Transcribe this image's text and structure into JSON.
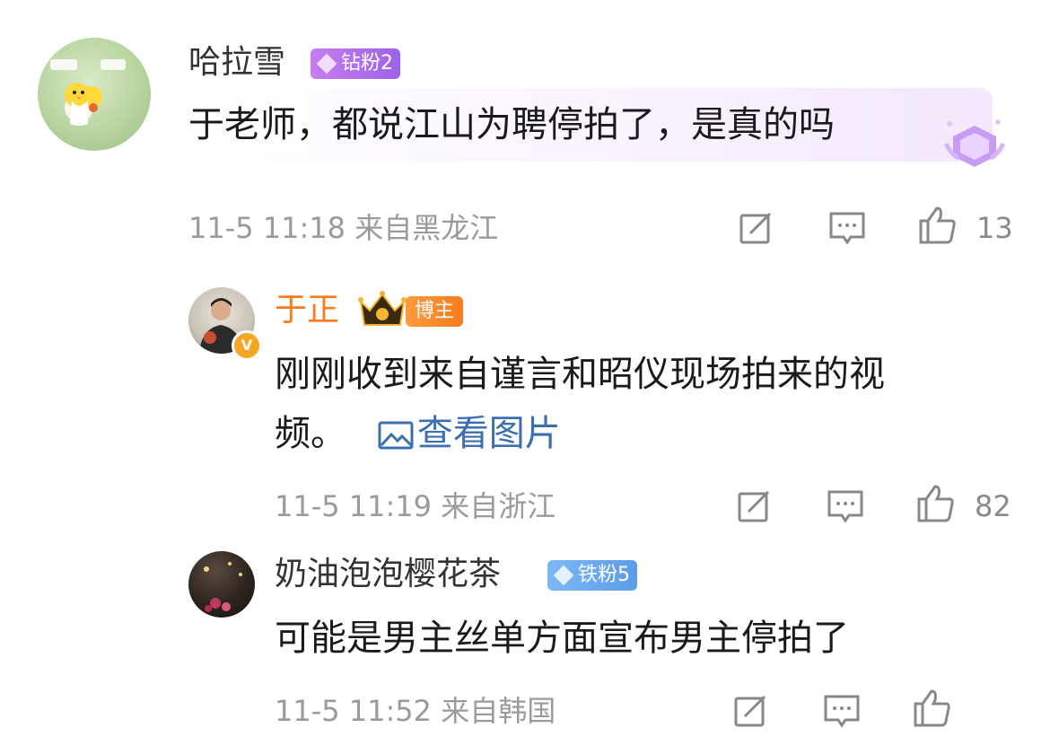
{
  "comments": [
    {
      "username": "哈拉雪",
      "badge": "钻粉2",
      "text": "于老师，都说江山为聘停拍了，是真的吗",
      "date": "11-5 11:18",
      "location": "来自黑龙江",
      "likes": "13"
    },
    {
      "username": "于正",
      "badge": "博主",
      "text_line1": "刚刚收到来自谨言和昭仪现场拍来的视",
      "text_line2": "频。",
      "link": "查看图片",
      "date": "11-5 11:19",
      "location": "来自浙江",
      "likes": "82"
    },
    {
      "username": "奶油泡泡樱花茶",
      "badge": "铁粉5",
      "text": "可能是男主丝单方面宣布男主停拍了",
      "date": "11-5 11:52",
      "location": "来自韩国"
    }
  ],
  "colors": {
    "badge_purple": "#b06cf0",
    "badge_blue": "#6aa8f0",
    "blogger_orange": "#ff7a1a",
    "link_blue": "#3b6fb2"
  }
}
